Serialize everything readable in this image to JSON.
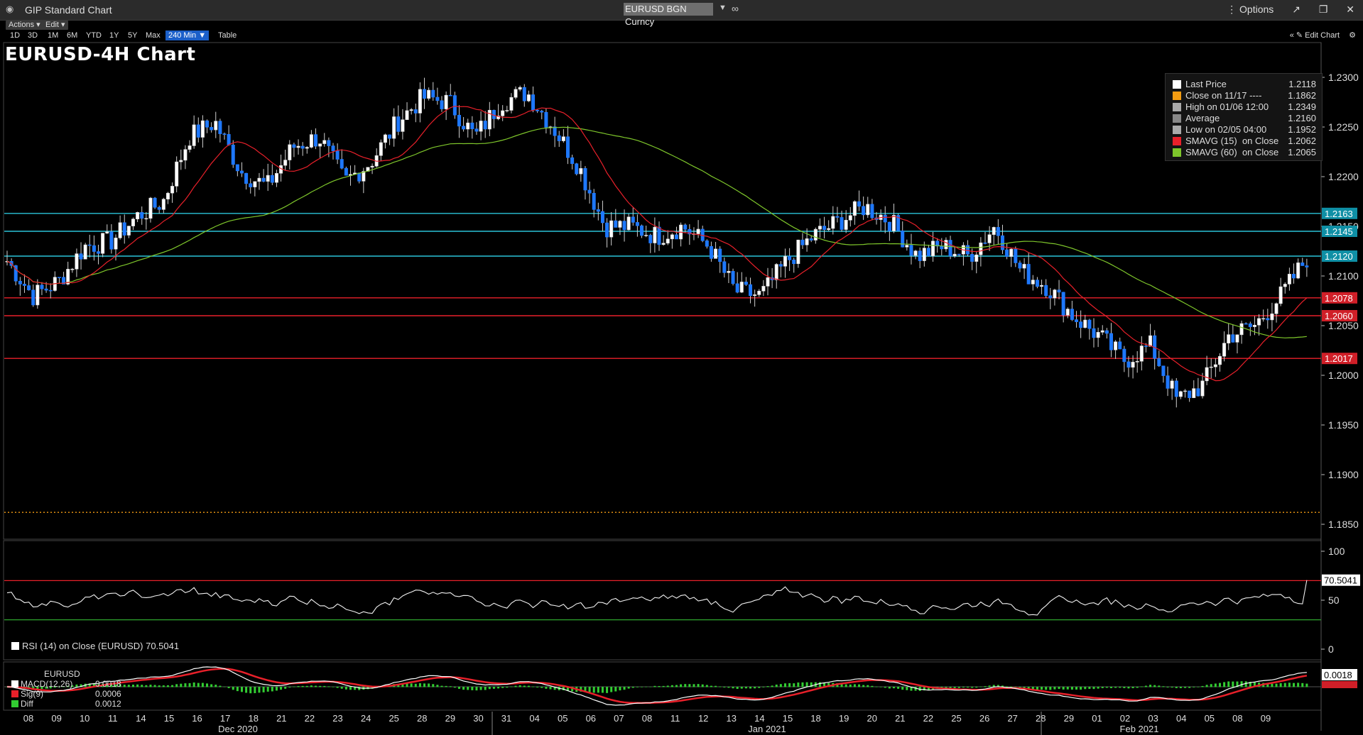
{
  "window": {
    "title": "GIP Standard Chart",
    "ticker": "EURUSD BGN Curncy",
    "options_label": "Options"
  },
  "toolbar": {
    "actions": "Actions ▾",
    "edit": "Edit ▾",
    "ranges": [
      "1D",
      "3D",
      "1M",
      "6M",
      "YTD",
      "1Y",
      "5Y",
      "Max"
    ],
    "interval": "240 Min ▼",
    "table": "Table",
    "edit_chart": "« ✎ Edit Chart",
    "settings_icon": "gear-icon"
  },
  "chart": {
    "title": "EURUSD-4H Chart"
  },
  "legend": {
    "rows": [
      {
        "label": "Last Price",
        "value": "1.2118",
        "color": "#ffffff"
      },
      {
        "label": "Close on 11/17 ----",
        "value": "1.1862",
        "color": "#f39c12"
      },
      {
        "label": "High on 01/06 12:00",
        "value": "1.2349",
        "color": "#aaaaaa"
      },
      {
        "label": "Average",
        "value": "1.2160",
        "color": "#888888"
      },
      {
        "label": "Low on 02/05 04:00",
        "value": "1.1952",
        "color": "#aaaaaa"
      },
      {
        "label": "SMAVG (15)  on Close",
        "value": "1.2062",
        "color": "#e8202a"
      },
      {
        "label": "SMAVG (60)  on Close",
        "value": "1.2065",
        "color": "#7ec62b"
      }
    ]
  },
  "rsi_legend": "RSI (14)  on Close (EURUSD) 70.5041",
  "macd_legend": {
    "title": "EURUSD",
    "rows": [
      {
        "label": "MACD(12,26)",
        "value": "0.0018",
        "color": "#ffffff"
      },
      {
        "label": "Sig(9)",
        "value": "0.0006",
        "color": "#e8202a"
      },
      {
        "label": "Diff",
        "value": "0.0012",
        "color": "#32cd32"
      }
    ]
  },
  "chart_data": {
    "type": "candlestick",
    "interval": "4H",
    "yaxis_ticks": [
      "1.2300",
      "1.2250",
      "1.2200",
      "1.2150",
      "1.2100",
      "1.2050",
      "1.2000",
      "1.1950",
      "1.1900",
      "1.1850"
    ],
    "ylim": [
      1.1835,
      1.231
    ],
    "close_series_daily": [
      1.2115,
      1.208,
      1.2095,
      1.213,
      1.2135,
      1.216,
      1.2175,
      1.224,
      1.2255,
      1.2205,
      1.219,
      1.223,
      1.224,
      1.2195,
      1.2215,
      1.2255,
      1.228,
      1.2275,
      1.224,
      1.2275,
      1.2285,
      1.225,
      1.221,
      1.215,
      1.215,
      1.214,
      1.215,
      1.213,
      1.2085,
      1.208,
      1.2115,
      1.214,
      1.2155,
      1.217,
      1.2155,
      1.212,
      1.213,
      1.212,
      1.215,
      1.2105,
      1.209,
      1.206,
      1.204,
      1.2015,
      1.203,
      1.1975,
      1.199,
      1.204,
      1.205,
      1.208,
      1.2118
    ],
    "horizontal_lines": [
      {
        "value": 1.2163,
        "label": "1.2163",
        "color": "#2ac3d8"
      },
      {
        "value": 1.2145,
        "label": "1.2145",
        "color": "#2ac3d8"
      },
      {
        "value": 1.212,
        "label": "1.2120",
        "color": "#2ac3d8"
      },
      {
        "value": 1.2078,
        "label": "1.2078",
        "color": "#e8202a"
      },
      {
        "value": 1.206,
        "label": "1.2060",
        "color": "#e8202a"
      },
      {
        "value": 1.2017,
        "label": "1.2017",
        "color": "#e8202a"
      }
    ],
    "x_labels": [
      "08",
      "09",
      "10",
      "11",
      "14",
      "15",
      "16",
      "17",
      "18",
      "21",
      "22",
      "23",
      "24",
      "25",
      "28",
      "29",
      "30",
      "31",
      "04",
      "05",
      "06",
      "07",
      "08",
      "11",
      "12",
      "13",
      "14",
      "15",
      "18",
      "19",
      "20",
      "21",
      "22",
      "25",
      "26",
      "27",
      "28",
      "29",
      "01",
      "02",
      "03",
      "04",
      "05",
      "08",
      "09"
    ],
    "month_labels": [
      "Dec 2020",
      "Jan 2021",
      "Feb 2021"
    ],
    "rsi": {
      "ticks": [
        "100",
        "50",
        "0"
      ],
      "upper": 70,
      "lower": 30,
      "last": "70.5041"
    },
    "macd": {
      "last_macd": "0.0018",
      "last_sig": "0.0006"
    }
  }
}
